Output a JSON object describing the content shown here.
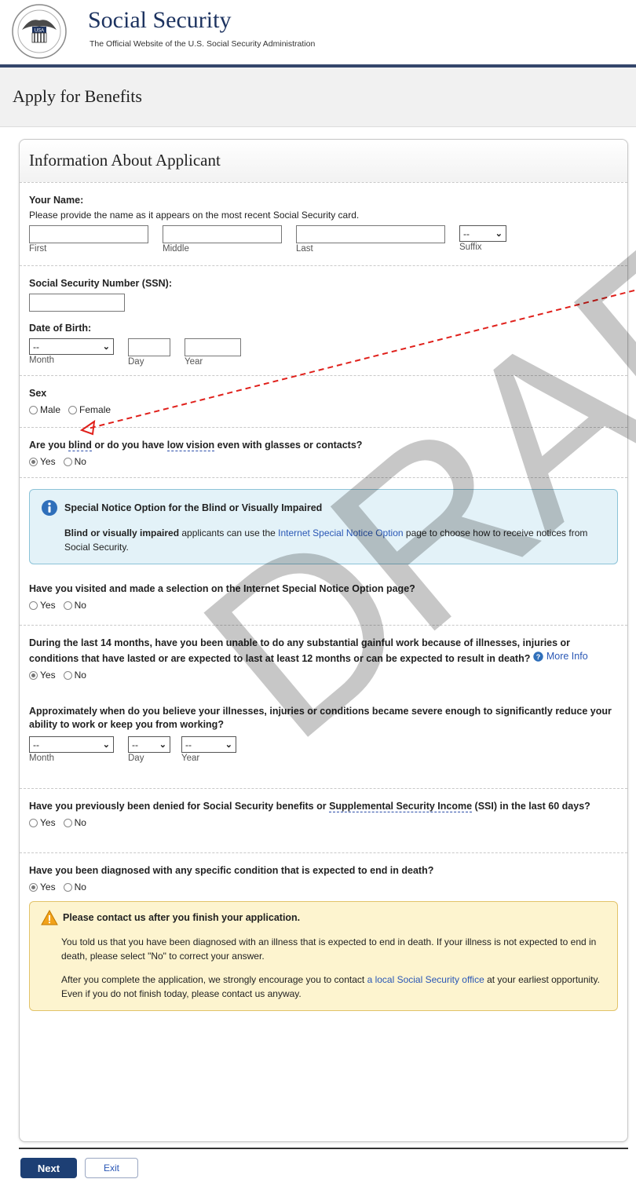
{
  "header": {
    "title": "Social Security",
    "tagline": "The Official Website of the U.S. Social Security Administration",
    "seal_label": "USA"
  },
  "page": {
    "title": "Apply for Benefits"
  },
  "panel": {
    "title": "Information About Applicant"
  },
  "name_section": {
    "label": "Your Name:",
    "hint": "Please provide the name as it appears on the most recent Social Security card.",
    "first_caption": "First",
    "middle_caption": "Middle",
    "last_caption": "Last",
    "suffix_caption": "Suffix",
    "suffix_value": "--"
  },
  "ssn_section": {
    "label": "Social Security Number (SSN):"
  },
  "dob_section": {
    "label": "Date of Birth:",
    "month_value": "--",
    "month_caption": "Month",
    "day_caption": "Day",
    "year_caption": "Year"
  },
  "sex_section": {
    "label": "Sex",
    "options": [
      "Male",
      "Female"
    ]
  },
  "blind_section": {
    "label_pre": "Are you ",
    "label_term1": "blind",
    "label_mid": " or do you have ",
    "label_term2": "low vision",
    "label_post": " even with glasses or contacts?",
    "yes": "Yes",
    "no": "No"
  },
  "notice_box": {
    "title": "Special Notice Option for the Blind or Visually Impaired",
    "bold_lead": "Blind or visually impaired",
    "text1": " applicants can use the ",
    "link": "Internet Special Notice Option",
    "text2": " page to choose how to receive notices from Social Security."
  },
  "visited_section": {
    "label": "Have you visited and made a selection on the Internet Special Notice Option page?",
    "yes": "Yes",
    "no": "No"
  },
  "work_section": {
    "label": "During the last 14 months, have you been unable to do any substantial gainful work because of illnesses, injuries or conditions that have lasted or are expected to last at least 12 months or can be expected to result in death?",
    "more_info": "More Info",
    "yes": "Yes",
    "no": "No"
  },
  "onset_section": {
    "label": "Approximately when do you believe your illnesses, injuries or conditions became severe enough to significantly reduce your ability to work or keep you from working?",
    "month_value": "--",
    "day_value": "--",
    "year_value": "--",
    "month_caption": "Month",
    "day_caption": "Day",
    "year_caption": "Year"
  },
  "denied_section": {
    "label_pre": "Have you previously been denied for Social Security benefits or ",
    "label_term": "Supplemental Security Income",
    "label_post": " (SSI) in the last 60 days?",
    "yes": "Yes",
    "no": "No"
  },
  "diagnosed_section": {
    "label": "Have you been diagnosed with any specific condition that is expected to end in death?",
    "yes": "Yes",
    "no": "No"
  },
  "warn_box": {
    "title": "Please contact us after you finish your application.",
    "p1": "You told us that you have been diagnosed with an illness that is expected to end in death. If your illness is not expected to end in death, please select \"No\" to correct your answer.",
    "p2_pre": "After you complete the application, we strongly encourage you to contact ",
    "p2_link": "a local Social Security office",
    "p2_post": " at your earliest opportunity. Even if you do not finish today, please contact us anyway."
  },
  "buttons": {
    "next": "Next",
    "exit": "Exit"
  },
  "watermark": "DRAFT",
  "colors": {
    "brand": "#1d3360",
    "link": "#2a57b5",
    "arrow": "#e0201b"
  }
}
